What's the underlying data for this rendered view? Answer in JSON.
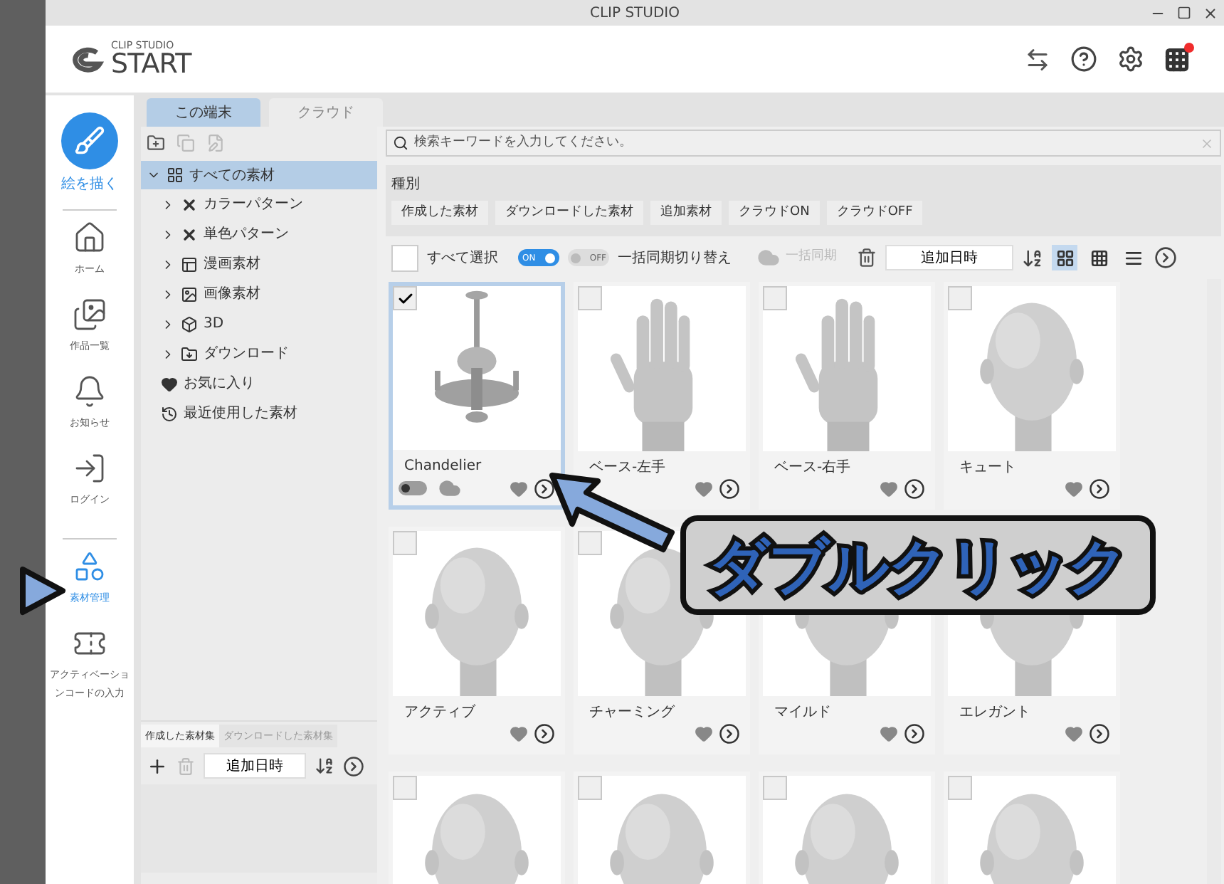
{
  "window": {
    "title": "CLIP STUDIO"
  },
  "header": {
    "logo_small": "CLIP STUDIO",
    "logo_big": "START",
    "notification": true
  },
  "nav": [
    {
      "label": "絵を描く",
      "selected": false,
      "kind": "primary"
    },
    {
      "label": "ホーム",
      "selected": false,
      "kind": "item"
    },
    {
      "label": "作品一覧",
      "selected": false,
      "kind": "item"
    },
    {
      "label": "お知らせ",
      "selected": false,
      "kind": "item"
    },
    {
      "label": "ログイン",
      "selected": false,
      "kind": "item"
    },
    {
      "label": "素材管理",
      "selected": true,
      "kind": "item"
    },
    {
      "label": "アクティベーションコードの入力",
      "selected": false,
      "kind": "item"
    }
  ],
  "tabs": [
    {
      "label": "この端末",
      "selected": true
    },
    {
      "label": "クラウド",
      "selected": false
    }
  ],
  "tree": {
    "label": "すべての素材",
    "expanded": true,
    "selected": true,
    "children": [
      {
        "label": "カラーパターン",
        "expandable": true
      },
      {
        "label": "単色パターン",
        "expandable": true
      },
      {
        "label": "漫画素材",
        "expandable": true
      },
      {
        "label": "画像素材",
        "expandable": true
      },
      {
        "label": "3D",
        "expandable": true
      },
      {
        "label": "ダウンロード",
        "expandable": true
      },
      {
        "label": "お気に入り",
        "expandable": false
      },
      {
        "label": "最近使用した素材",
        "expandable": false
      }
    ]
  },
  "bottom_panel": {
    "tabs": [
      {
        "label": "作成した素材集",
        "selected": true
      },
      {
        "label": "ダウンロードした素材集",
        "selected": false
      }
    ],
    "sort": "追加日時"
  },
  "search": {
    "placeholder": "検索キーワードを入力してください。"
  },
  "filter": {
    "label": "種別",
    "chips": [
      "作成した素材",
      "ダウンロードした素材",
      "追加素材",
      "クラウドON",
      "クラウドOFF"
    ]
  },
  "toolbar": {
    "select_all": {
      "label": "すべて選択",
      "checked": false
    },
    "toggle_on": {
      "label": "ON",
      "on": true
    },
    "toggle_off": {
      "label": "OFF",
      "on": false
    },
    "toggle_caption": "一括同期切り替え",
    "sync": {
      "label": "一括同期",
      "disabled": true
    },
    "sort": "追加日時",
    "views": [
      {
        "selected": true
      },
      {
        "selected": false
      },
      {
        "selected": false
      }
    ]
  },
  "cards": [
    {
      "name": "Chandelier",
      "kind": "chandelier",
      "checked": true,
      "selected": true,
      "show_sync": true
    },
    {
      "name": "ベース-左手",
      "kind": "hand",
      "checked": false,
      "selected": false,
      "show_sync": false
    },
    {
      "name": "ベース-右手",
      "kind": "hand",
      "checked": false,
      "selected": false,
      "show_sync": false
    },
    {
      "name": "キュート",
      "kind": "head",
      "checked": false,
      "selected": false,
      "show_sync": false
    },
    {
      "name": "アクティブ",
      "kind": "head",
      "checked": false,
      "selected": false,
      "show_sync": false
    },
    {
      "name": "チャーミング",
      "kind": "head",
      "checked": false,
      "selected": false,
      "show_sync": false
    },
    {
      "name": "マイルド",
      "kind": "head",
      "selected": false,
      "show_sync": false
    },
    {
      "name": "エレガント",
      "kind": "head",
      "selected": false,
      "show_sync": false
    },
    {
      "kind": "head",
      "checked": false,
      "selected": false
    },
    {
      "kind": "head",
      "checked": false,
      "selected": false
    },
    {
      "kind": "head",
      "checked": false,
      "selected": false
    },
    {
      "kind": "head",
      "checked": false,
      "selected": false
    }
  ],
  "annotation": {
    "callout": "ダブルクリック"
  }
}
